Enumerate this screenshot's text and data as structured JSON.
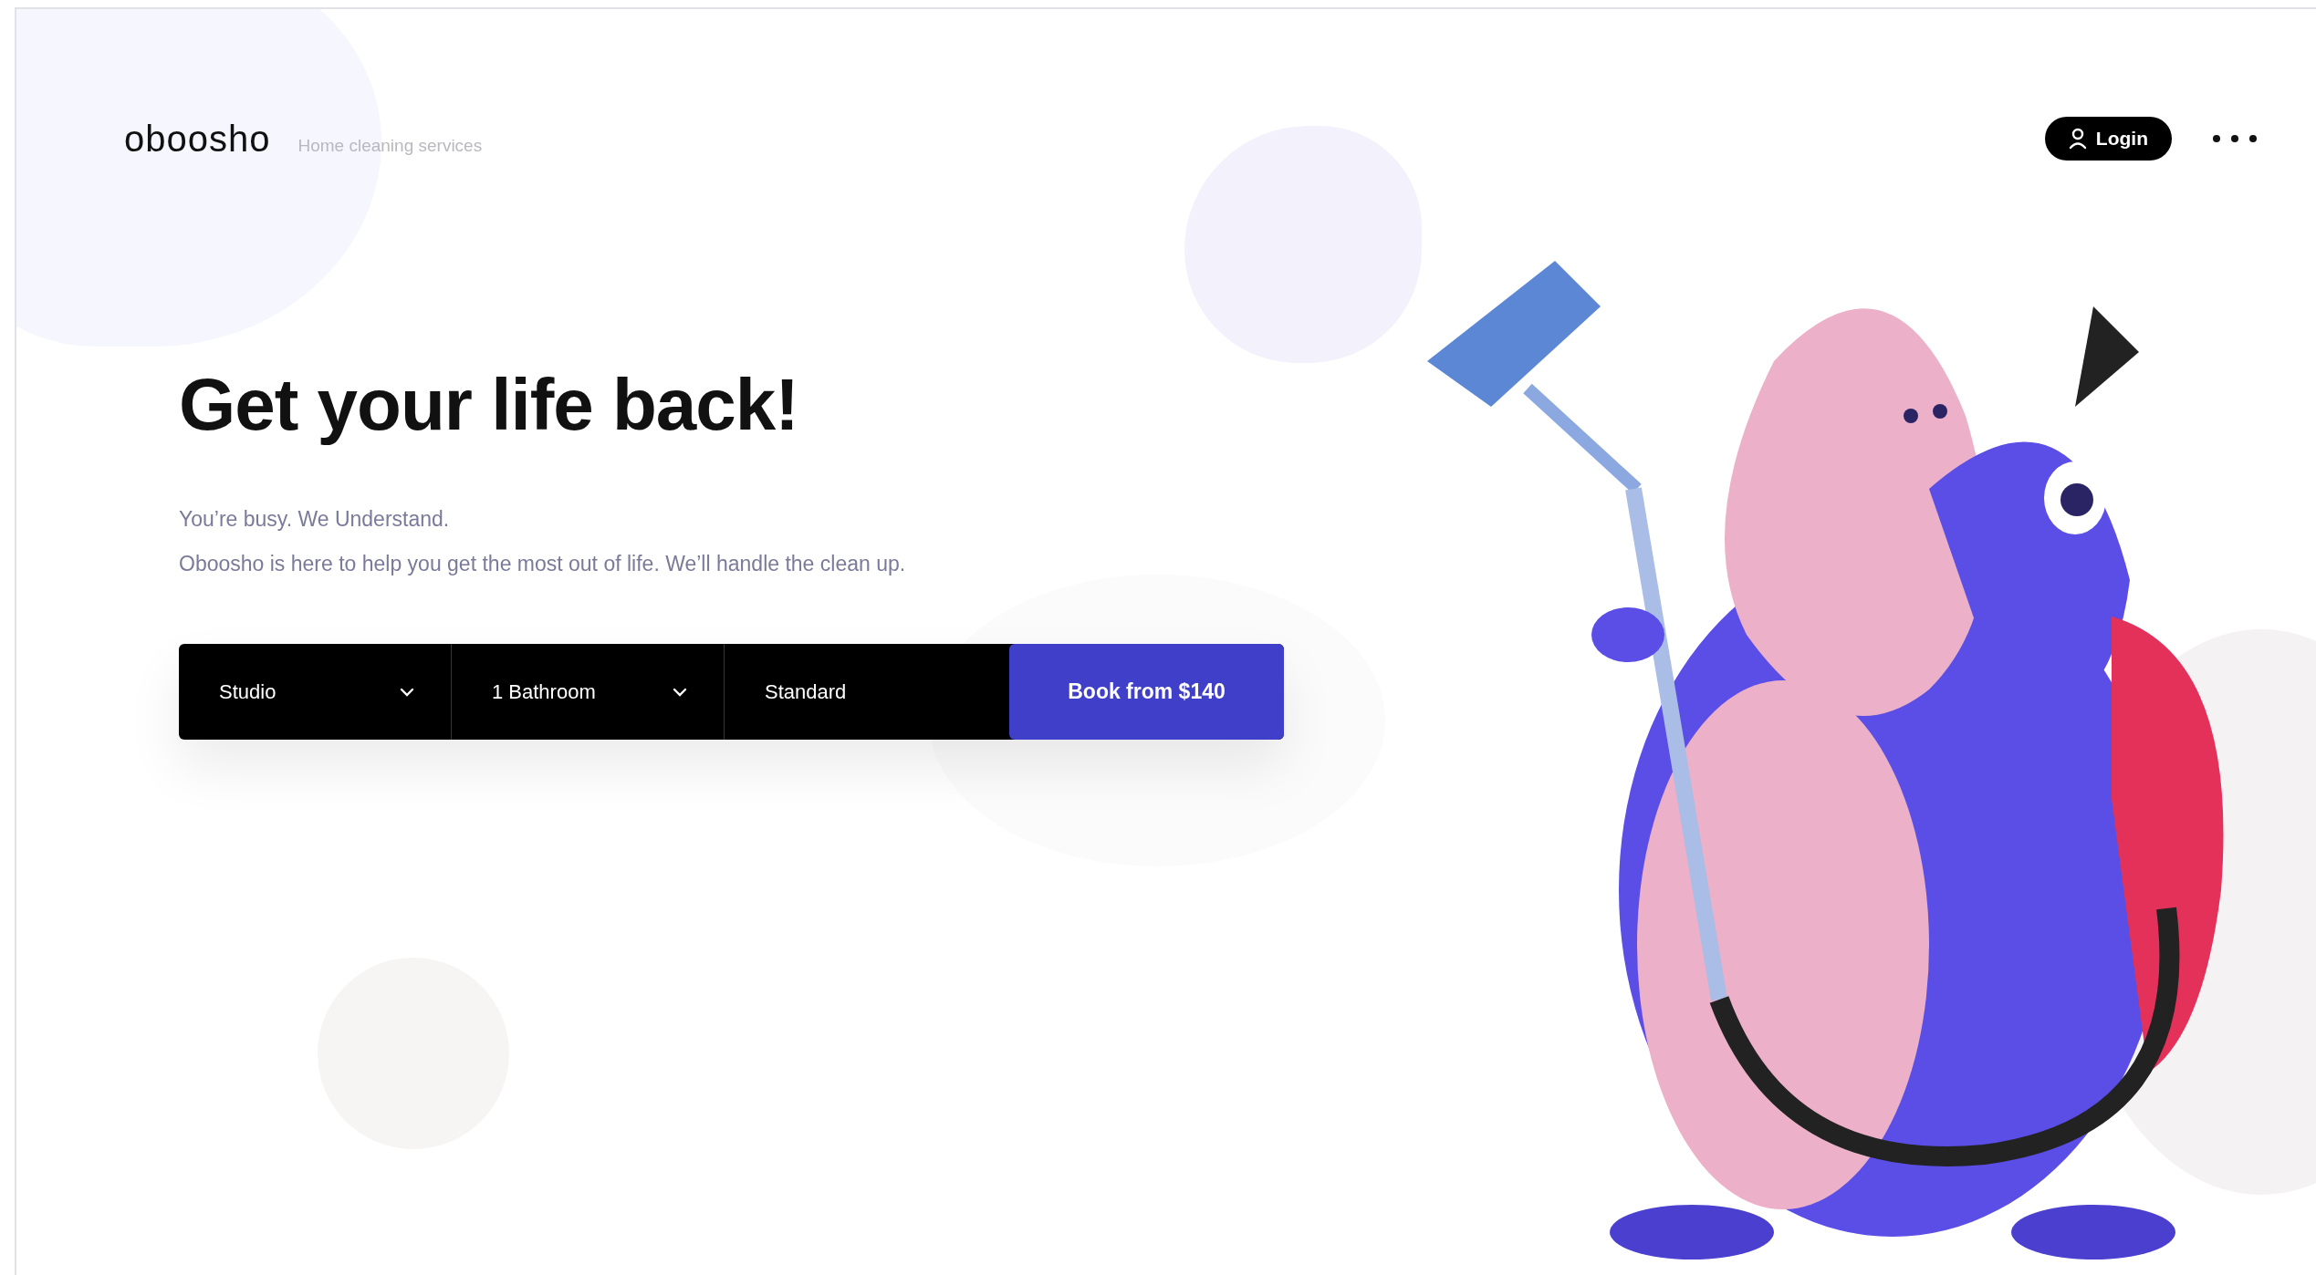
{
  "header": {
    "logo": "oboosho",
    "tagline": "Home cleaning services",
    "login_button": "Login"
  },
  "hero": {
    "title": "Get your life back!",
    "lines": [
      "You’re busy. We Understand.",
      "Oboosho is here to help you get the most out of life. We’ll handle the clean up."
    ]
  },
  "booking_form": {
    "fields": [
      {
        "kind": "select",
        "value": "Studio"
      },
      {
        "kind": "select",
        "value": "1 Bathroom"
      },
      {
        "kind": "text",
        "value": "Standard"
      }
    ],
    "button": "Book from $140"
  }
}
